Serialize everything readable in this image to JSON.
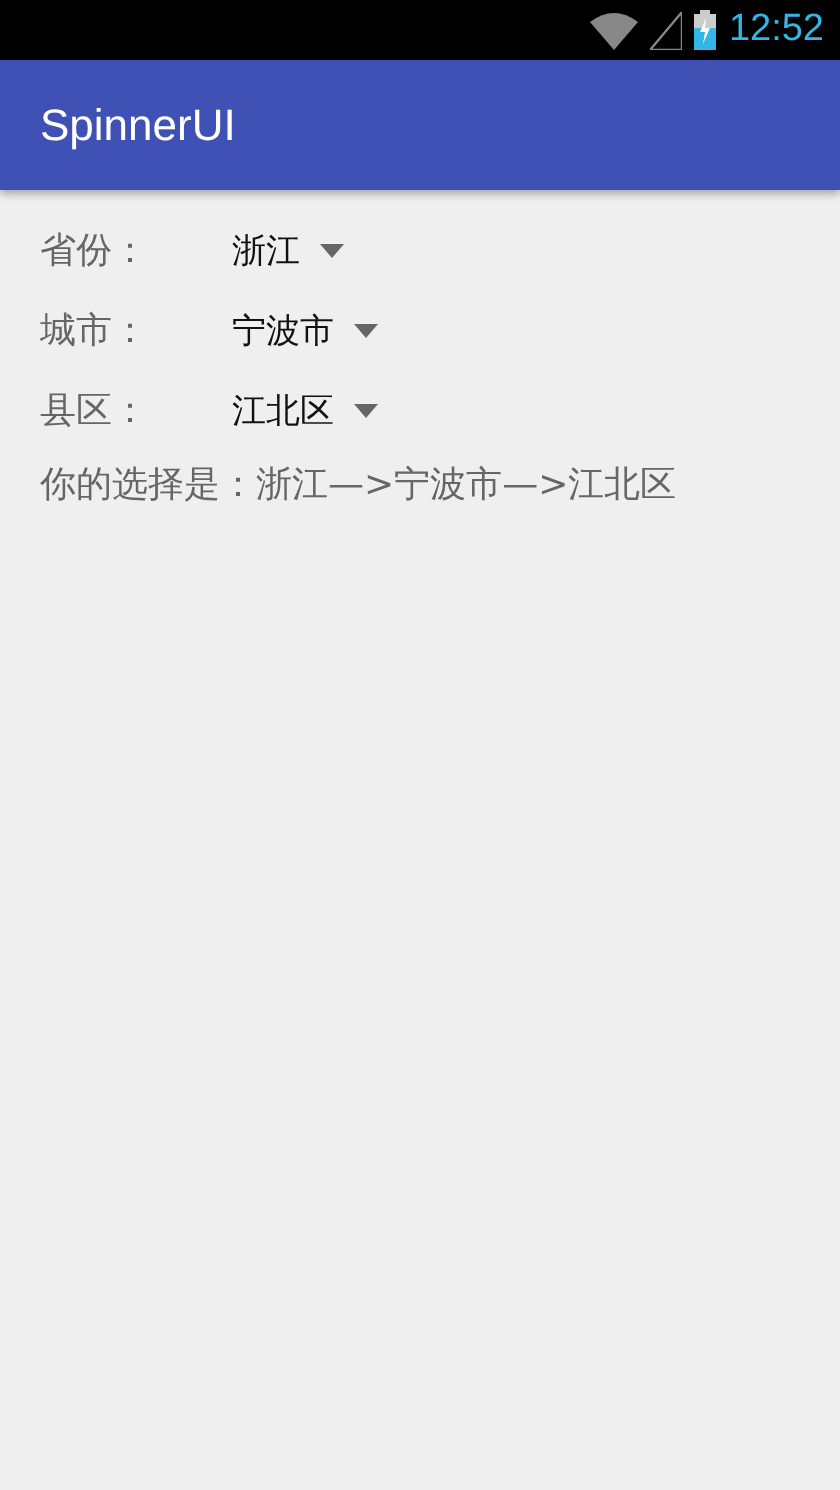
{
  "status_bar": {
    "time": "12:52"
  },
  "app_bar": {
    "title": "SpinnerUI"
  },
  "spinners": [
    {
      "label": "省份：",
      "value": "浙江"
    },
    {
      "label": "城市：",
      "value": "宁波市"
    },
    {
      "label": "县区：",
      "value": "江北区"
    }
  ],
  "result": "你的选择是：浙江—>宁波市—>江北区"
}
